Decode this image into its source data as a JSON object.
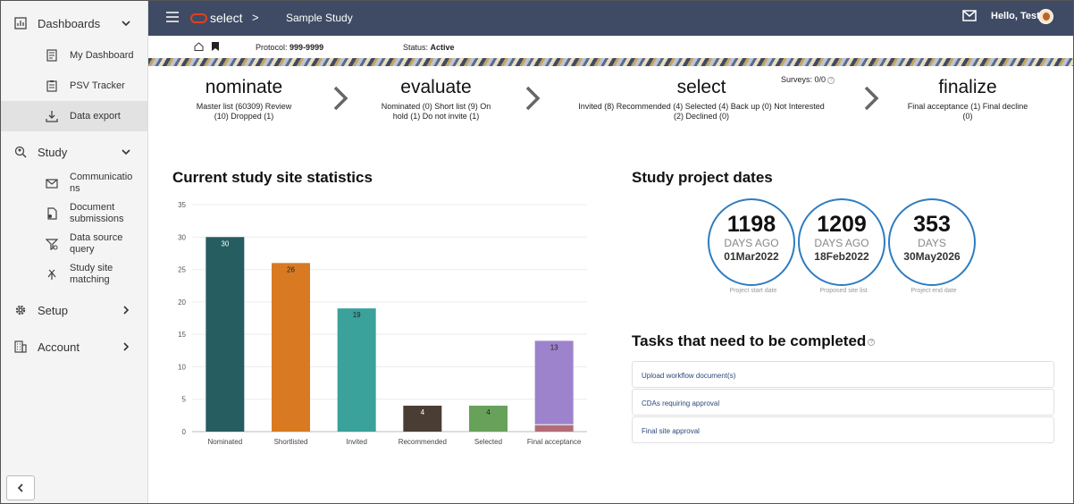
{
  "sidebar": {
    "groups": [
      {
        "label": "Dashboards"
      },
      {
        "label": "Study"
      },
      {
        "label": "Setup"
      },
      {
        "label": "Account"
      }
    ],
    "dashboard_items": [
      {
        "label": "My Dashboard"
      },
      {
        "label": "PSV Tracker"
      },
      {
        "label": "Data export"
      }
    ],
    "study_items": [
      {
        "label_lines": [
          "Communicatio",
          "ns"
        ]
      },
      {
        "label_lines": [
          "Document",
          "submissions"
        ]
      },
      {
        "label_lines": [
          "Data source",
          "query"
        ]
      },
      {
        "label_lines": [
          "Study site",
          "matching"
        ]
      }
    ]
  },
  "header": {
    "logo_text": "select",
    "separator": ">",
    "title": "Sample Study",
    "greeting": "Hello, Test"
  },
  "subbar": {
    "protocol_label": "Protocol:",
    "protocol_value": "999-9999",
    "status_label": "Status:",
    "status_value": "Active"
  },
  "steps": [
    {
      "title": "nominate",
      "lines": [
        "Master list (60309)  Review",
        "(10)  Dropped (1)"
      ]
    },
    {
      "title": "evaluate",
      "lines": [
        "Nominated (0)  Short list (9)  On",
        "hold (1)  Do not invite (1)"
      ]
    },
    {
      "title": "select",
      "lines": [
        "Invited (8)  Recommended (4)  Selected (4)  Back up (0)  Not Interested",
        "(2)  Declined (0)"
      ]
    },
    {
      "title": "finalize",
      "lines": [
        "Final acceptance (1)  Final decline",
        "(0)"
      ]
    }
  ],
  "surveys": "Surveys: 0/0",
  "stats_title": "Current study site statistics",
  "chart_data": {
    "type": "bar",
    "categories": [
      "Nominated",
      "Shortlisted",
      "Invited",
      "Recommended",
      "Selected",
      "Final acceptance"
    ],
    "values": [
      30,
      26,
      19,
      4,
      4,
      13
    ],
    "stacked_bottom": [
      0,
      0,
      0,
      0,
      0,
      1
    ],
    "colors": [
      "#265d60",
      "#d97a22",
      "#3aa19b",
      "#4a3d33",
      "#68a15a",
      "#9d82cc"
    ],
    "bottom_color": "#b26c78",
    "yticks": [
      0,
      5,
      10,
      15,
      20,
      25,
      30,
      35
    ],
    "ylim": [
      0,
      35
    ],
    "grid": true
  },
  "dates_title": "Study project dates",
  "dates": [
    {
      "value": "1198",
      "unit": "DAYS AGO",
      "date": "01Mar2022",
      "caption": "Project start date"
    },
    {
      "value": "1209",
      "unit": "DAYS AGO",
      "date": "18Feb2022",
      "caption": "Proposed site list"
    },
    {
      "value": "353",
      "unit": "DAYS",
      "date": "30May2026",
      "caption": "Project end date"
    }
  ],
  "tasks_title": "Tasks that need to be completed",
  "tasks": [
    {
      "label": "Upload workflow document(s)"
    },
    {
      "label": "CDAs requiring approval"
    },
    {
      "label": "Final site approval"
    }
  ]
}
